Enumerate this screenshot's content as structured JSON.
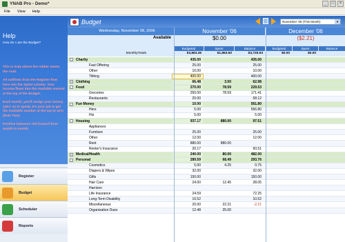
{
  "app": {
    "title": "YNAB Pro - Demo*",
    "window_buttons": [
      "_",
      "□",
      "×"
    ]
  },
  "menu": [
    "File",
    "View",
    "Help"
  ],
  "help": {
    "title": "Help",
    "question": "How do I use the Budget?",
    "paragraphs": [
      "This is truly where the rubber meets the road.",
      "All outflows from the Register flow here into the Spent column. Your income flows into the Available amount at the top of the Budget.",
      "Each month, you'll assign your money 'jobs' so to speak. It's your job to get the Available number at the top to zero (Rule Two).",
      "Positive balances roll forward from month to month."
    ]
  },
  "nav": [
    {
      "label": "Register",
      "active": false,
      "color": "#5aa0e6"
    },
    {
      "label": "Budget",
      "active": true,
      "color": "#e89b2c"
    },
    {
      "label": "Scheduler",
      "active": false,
      "color": "#3ba04a"
    },
    {
      "label": "Reports",
      "active": false,
      "color": "#d43a3a"
    }
  ],
  "banner": {
    "title": "Budget",
    "month_select": "November '06 (This Month)"
  },
  "header": {
    "date": "Wednesday, November 08, 2006",
    "available_label": "Available",
    "months": [
      {
        "name": "November '06",
        "available": "$0.00",
        "available_color": "#000000",
        "cols": [
          "Budgeted",
          "Spent",
          "Balance"
        ],
        "totals": [
          "$3,863.36",
          "$1,863.60",
          "$3,725.53"
        ]
      },
      {
        "name": "December '06",
        "available": "($2.21)",
        "available_color": "#c0392b",
        "cols": [
          "Budgeted",
          "Spent",
          "Balance"
        ],
        "totals": [
          "$0.00",
          "$0.00",
          ""
        ]
      }
    ],
    "totals_label": "MonthlyTotals"
  },
  "rows": [
    {
      "type": "cat",
      "name": "Charity",
      "exp": "-",
      "v": [
        "435.00",
        "",
        "435.00"
      ]
    },
    {
      "type": "sub",
      "name": "Fast Offering",
      "v": [
        "25.00",
        "",
        "25.00"
      ]
    },
    {
      "type": "sub",
      "name": "Other",
      "v": [
        "10.00",
        "",
        "10.00"
      ]
    },
    {
      "type": "sub",
      "name": "Tithing",
      "v": [
        "400.00",
        "",
        "400.00"
      ],
      "selected": true
    },
    {
      "type": "cat",
      "name": "Clothing",
      "exp": "+",
      "v": [
        "66.48",
        "3.50",
        "62.98"
      ]
    },
    {
      "type": "cat",
      "name": "Food",
      "exp": "-",
      "v": [
        "270.00",
        "78.59",
        "229.53"
      ]
    },
    {
      "type": "sub",
      "name": "Groceries",
      "v": [
        "250.00",
        "78.59",
        "171.41"
      ]
    },
    {
      "type": "sub",
      "name": "Restaurants",
      "v": [
        "20.00",
        "",
        "58.12"
      ]
    },
    {
      "type": "cat",
      "name": "Fun Money",
      "exp": "-",
      "v": [
        "10.00",
        "",
        "561.80"
      ]
    },
    {
      "type": "sub",
      "name": "Hers",
      "v": [
        "5.00",
        "",
        "556.80"
      ]
    },
    {
      "type": "sub",
      "name": "His",
      "v": [
        "5.00",
        "",
        "5.00"
      ]
    },
    {
      "type": "cat",
      "name": "Housing",
      "exp": "-",
      "v": [
        "937.17",
        "880.00",
        "97.51"
      ]
    },
    {
      "type": "sub",
      "name": "Appliances",
      "v": [
        "",
        "",
        ""
      ]
    },
    {
      "type": "sub",
      "name": "Furniture",
      "v": [
        "25.00",
        "",
        "25.00"
      ]
    },
    {
      "type": "sub",
      "name": "Other",
      "v": [
        "12.00",
        "",
        "12.00"
      ]
    },
    {
      "type": "sub",
      "name": "Rent",
      "v": [
        "880.00",
        "880.00",
        ""
      ]
    },
    {
      "type": "sub",
      "name": "Renter's Insurance",
      "v": [
        "20.17",
        "",
        "60.51"
      ]
    },
    {
      "type": "cat",
      "name": "Medical/Health",
      "exp": "+",
      "v": [
        "240.00",
        "80.00",
        "482.00"
      ]
    },
    {
      "type": "cat",
      "name": "Personal",
      "exp": "-",
      "v": [
        "289.59",
        "68.49",
        "293.76"
      ]
    },
    {
      "type": "sub",
      "name": "Cosmetics",
      "v": [
        "5.00",
        "4.25",
        "0.75"
      ]
    },
    {
      "type": "sub",
      "name": "Diapers & Wipes",
      "v": [
        "32.00",
        "",
        "32.00"
      ]
    },
    {
      "type": "sub",
      "name": "Gifts",
      "v": [
        "150.00",
        "",
        "150.00"
      ]
    },
    {
      "type": "sub",
      "name": "Hair Care",
      "v": [
        "24.00",
        "12.45",
        "28.05"
      ]
    },
    {
      "type": "sub",
      "name": "Harrison",
      "v": [
        "",
        "",
        ""
      ]
    },
    {
      "type": "sub",
      "name": "Life Insurance",
      "v": [
        "24.59",
        "",
        "72.25"
      ]
    },
    {
      "type": "sub",
      "name": "Long-Term Disability",
      "v": [
        "10.52",
        "",
        "10.52"
      ]
    },
    {
      "type": "sub",
      "name": "Miscellaneous",
      "v": [
        "20.00",
        "22.21",
        "-2.21"
      ]
    },
    {
      "type": "sub",
      "name": "Organization Dues",
      "v": [
        "12.48",
        "25.00",
        ""
      ]
    }
  ],
  "colors": {
    "banner": "#2e6bc4",
    "category_row": "#d9ecc9",
    "negative": "#c0392b"
  }
}
